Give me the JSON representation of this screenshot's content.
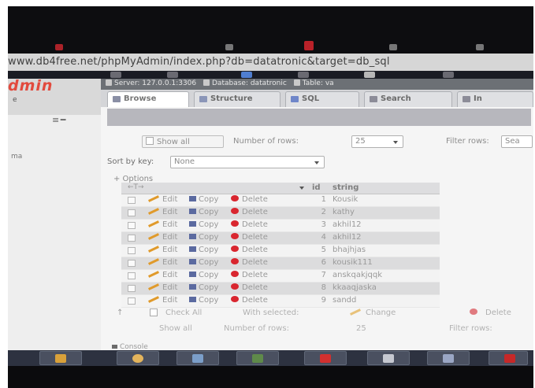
{
  "browser": {
    "address": "www.db4free.net/phpMyAdmin/index.php?db=datatronic&target=db_sql"
  },
  "app": {
    "logo_text": "dmin",
    "nav_glyph": "e",
    "nav_toggle": "≡ ━",
    "nav_item": "ma"
  },
  "breadcrumb": {
    "server": "Server: 127.0.0.1:3306",
    "database": "Database: datatronic",
    "table": "Table: va"
  },
  "tabs": [
    {
      "label": "Browse",
      "icon": "browse-icon",
      "active": true
    },
    {
      "label": "Structure",
      "icon": "structure-icon",
      "active": false
    },
    {
      "label": "SQL",
      "icon": "sql-icon",
      "active": false
    },
    {
      "label": "Search",
      "icon": "search-icon",
      "active": false
    },
    {
      "label": "In",
      "icon": "insert-icon",
      "active": false
    }
  ],
  "navigation": {
    "show_all": "Show all",
    "rows_label": "Number of rows:",
    "rows_value": "25",
    "filter_label": "Filter rows:",
    "filter_placeholder": "Sea"
  },
  "sort": {
    "label": "Sort by key:",
    "value": "None"
  },
  "options_label": "+ Options",
  "table": {
    "columns": [
      "id",
      "string"
    ],
    "arrows": "←T→",
    "actions": {
      "edit": "Edit",
      "copy": "Copy",
      "delete": "Delete"
    },
    "rows": [
      {
        "id": "1",
        "string": "Kousik"
      },
      {
        "id": "2",
        "string": "kathy"
      },
      {
        "id": "3",
        "string": "akhil12"
      },
      {
        "id": "4",
        "string": "akhil12"
      },
      {
        "id": "5",
        "string": "bhajhjas"
      },
      {
        "id": "6",
        "string": "kousik111"
      },
      {
        "id": "7",
        "string": "anskqakjqqk"
      },
      {
        "id": "8",
        "string": "kkaaqjaska"
      },
      {
        "id": "9",
        "string": "sandd"
      }
    ]
  },
  "bulk": {
    "check_all": "Check All",
    "with_selected": "With selected:",
    "change": "Change",
    "delete": "Delete"
  },
  "navigation_bottom": {
    "show_all": "Show all",
    "rows_label": "Number of rows:",
    "rows_value": "25",
    "filter_label": "Filter rows:"
  },
  "console_label": "Console",
  "colors": {
    "accent_logo": "#e24a3d",
    "edit_icon": "#e09a2b",
    "delete_icon": "#d9262f",
    "copy_icon": "#5b6aa0"
  },
  "taskbar": [
    "explorer-icon",
    "media-icon",
    "chrome-icon",
    "pdf-icon",
    "folder-icon",
    "window-icon",
    "app-icon"
  ]
}
